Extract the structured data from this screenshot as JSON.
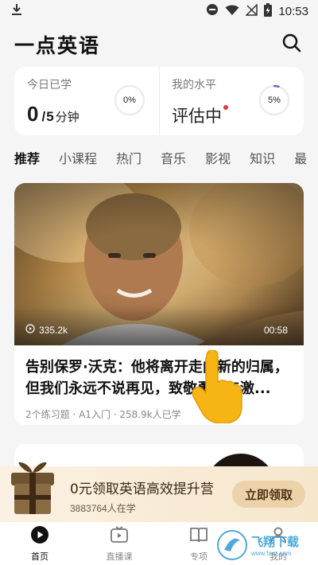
{
  "status_bar": {
    "time": "10:53",
    "icons": [
      "download-icon",
      "dnd-icon",
      "wifi-icon",
      "signal-off-icon",
      "battery-charging-icon"
    ]
  },
  "header": {
    "title": "一点英语",
    "search_icon": "search-icon"
  },
  "stats": {
    "today": {
      "label": "今日已学",
      "value": "0",
      "separator": "/",
      "goal": "5",
      "unit": "分钟",
      "progress": "0%",
      "progress_fraction": 0
    },
    "level": {
      "label": "我的水平",
      "value": "评估中",
      "progress": "5%",
      "progress_fraction": 0.05
    }
  },
  "tabs": [
    "推荐",
    "小课程",
    "热门",
    "音乐",
    "影视",
    "知识",
    "最"
  ],
  "active_tab": 0,
  "video": {
    "views": "335.2k",
    "duration": "00:58",
    "title": "告别保罗·沃克：他将离开走向新的归属，但我们永远不说再见，致敬勇气与激...",
    "meta": "2个练习题 · A1入门 · 258.9k人已学"
  },
  "promo": {
    "title": "0元领取英语高效提升营",
    "subtitle": "3883764人在学",
    "button": "立即领取"
  },
  "bottom_nav": [
    {
      "label": "首页",
      "icon": "home-play-icon"
    },
    {
      "label": "直播课",
      "icon": "tv-icon"
    },
    {
      "label": "专项",
      "icon": "book-icon"
    },
    {
      "label": "我的",
      "icon": "user-icon"
    }
  ],
  "watermark": {
    "text": "飞翔下载",
    "sub": "www.fxxz.com"
  },
  "colors": {
    "accent": "#111111",
    "ring_progress": "#6c63d9",
    "red_dot": "#e33b3b",
    "promo_button": "#ecd2a8"
  }
}
